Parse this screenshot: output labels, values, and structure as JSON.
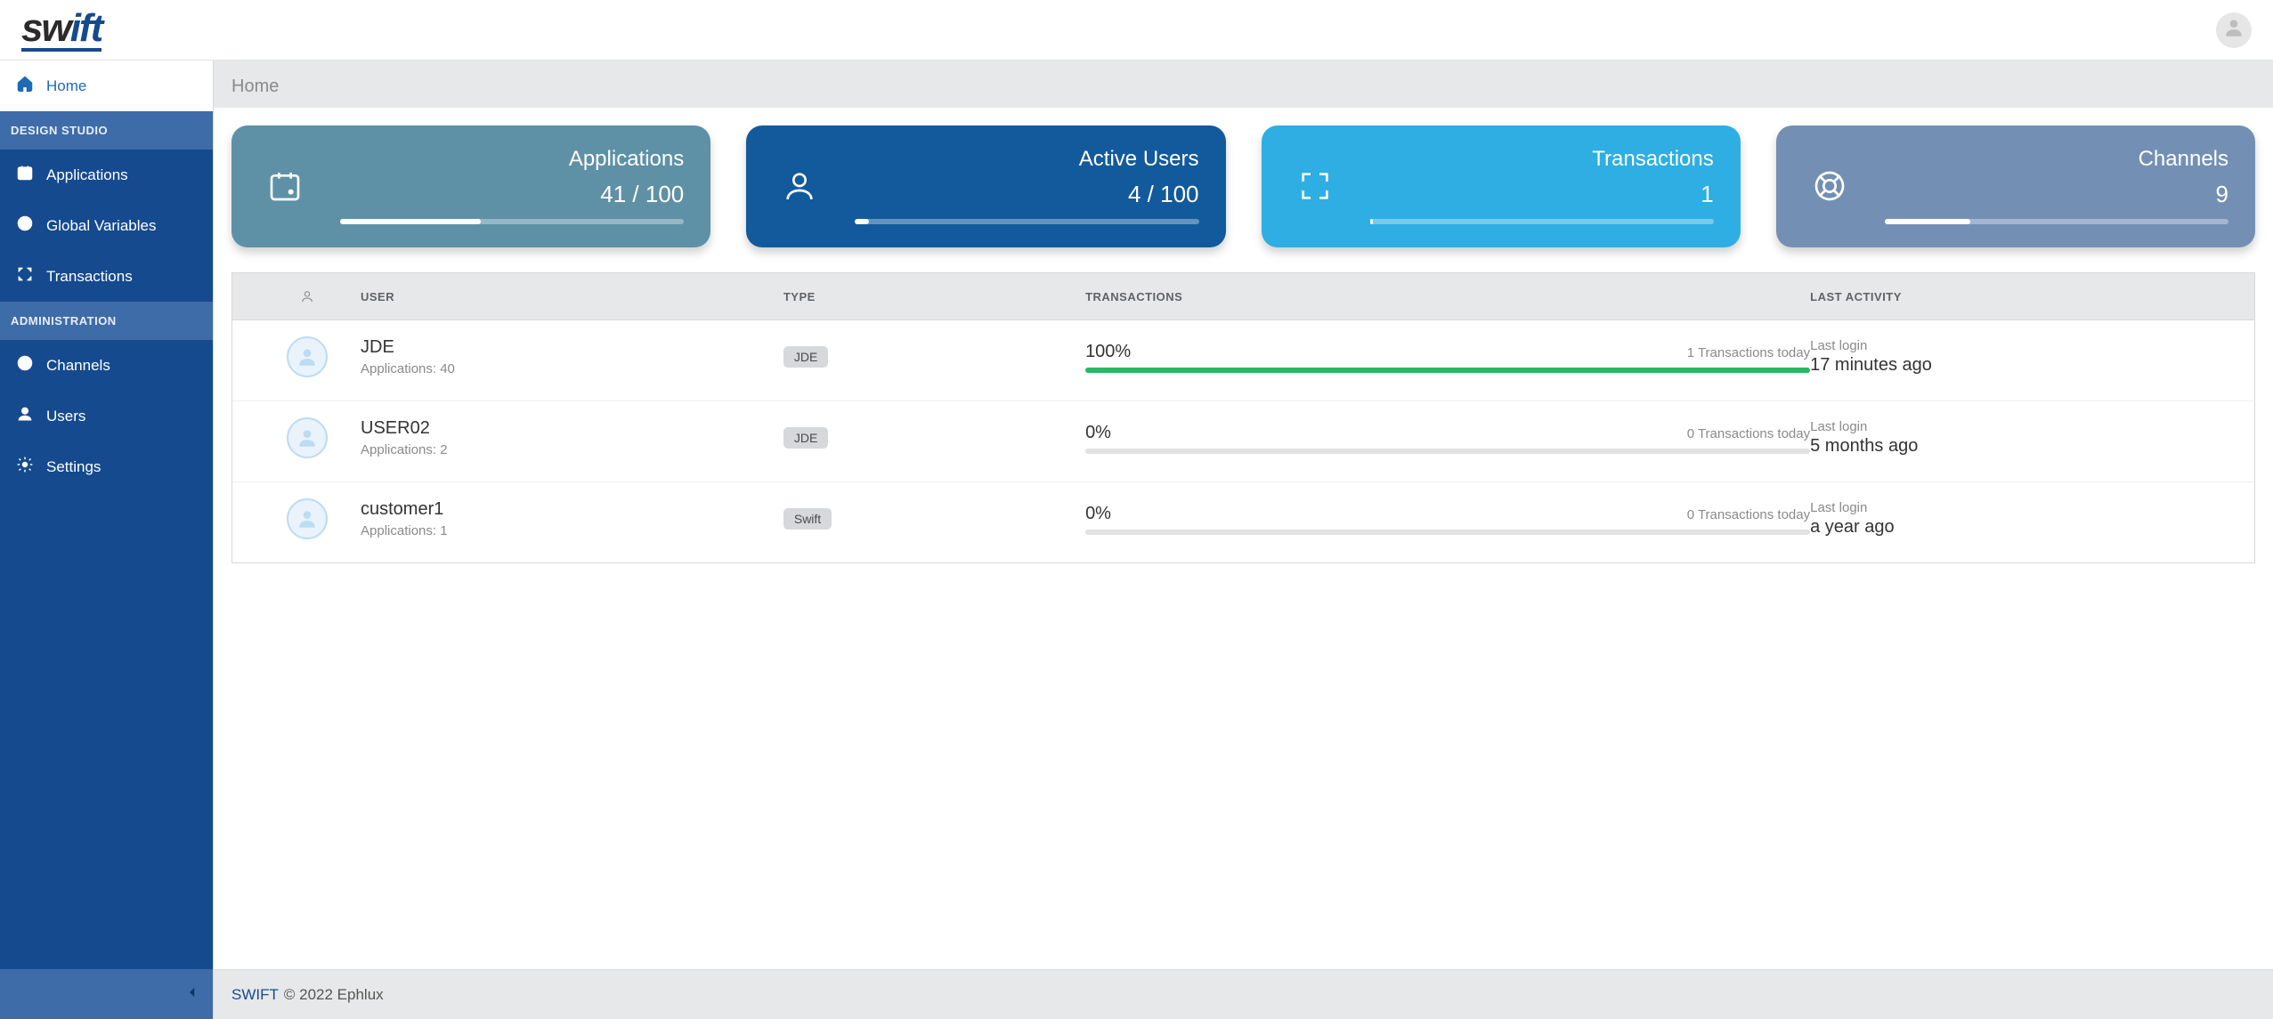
{
  "header": {
    "logo_prefix": "sw",
    "logo_suffix": "ift"
  },
  "sidebar": {
    "home": "Home",
    "section_design": "DESIGN STUDIO",
    "applications": "Applications",
    "global_vars": "Global Variables",
    "transactions": "Transactions",
    "section_admin": "ADMINISTRATION",
    "channels": "Channels",
    "users": "Users",
    "settings": "Settings"
  },
  "breadcrumb": "Home",
  "cards": {
    "applications": {
      "title": "Applications",
      "value": "41 / 100",
      "fill_pct": 41
    },
    "active_users": {
      "title": "Active Users",
      "value": "4 / 100",
      "fill_pct": 4
    },
    "transactions": {
      "title": "Transactions",
      "value": "1",
      "fill_pct": 1
    },
    "channels": {
      "title": "Channels",
      "value": "9",
      "fill_pct": 25
    }
  },
  "table": {
    "headers": {
      "user": "USER",
      "type": "TYPE",
      "transactions": "TRANSACTIONS",
      "last_activity": "LAST ACTIVITY"
    },
    "rows": [
      {
        "name": "JDE",
        "apps_label": "Applications: 40",
        "type": "JDE",
        "tx_pct_label": "100%",
        "tx_pct": 100,
        "tx_today": "1 Transactions today",
        "last_label": "Last login",
        "last_value": "17 minutes ago"
      },
      {
        "name": "USER02",
        "apps_label": "Applications: 2",
        "type": "JDE",
        "tx_pct_label": "0%",
        "tx_pct": 0,
        "tx_today": "0 Transactions today",
        "last_label": "Last login",
        "last_value": "5 months ago"
      },
      {
        "name": "customer1",
        "apps_label": "Applications: 1",
        "type": "Swift",
        "tx_pct_label": "0%",
        "tx_pct": 0,
        "tx_today": "0 Transactions today",
        "last_label": "Last login",
        "last_value": "a year ago"
      }
    ]
  },
  "footer": {
    "brand": "SWIFT",
    "text": "© 2022 Ephlux"
  }
}
